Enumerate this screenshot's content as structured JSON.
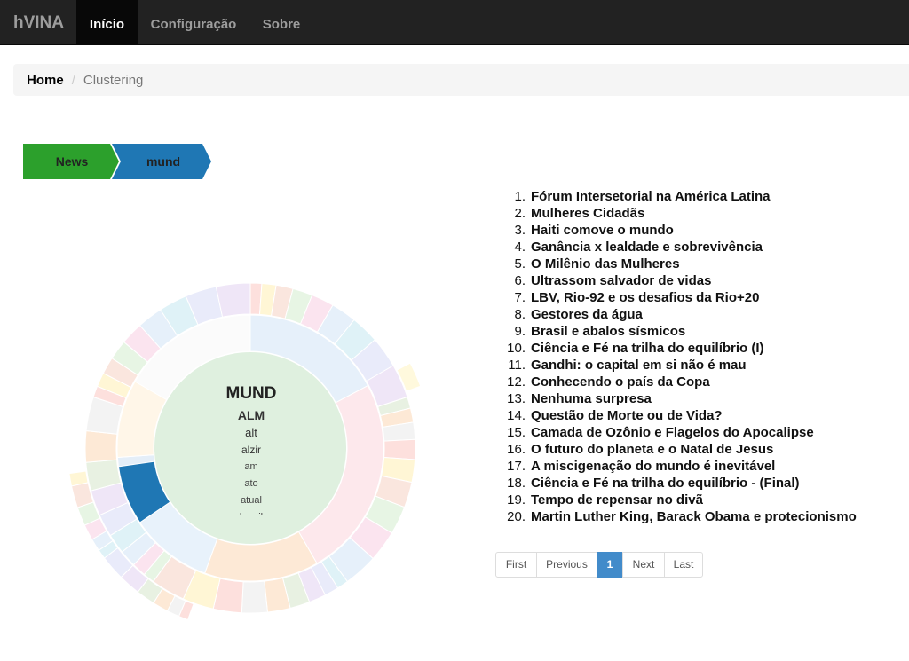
{
  "navbar": {
    "brand": "hVINA",
    "items": [
      {
        "label": "Início",
        "active": true
      },
      {
        "label": "Configuração",
        "active": false
      },
      {
        "label": "Sobre",
        "active": false
      }
    ]
  },
  "breadcrumb": {
    "home": "Home",
    "separator": "/",
    "current": "Clustering"
  },
  "trail": {
    "items": [
      {
        "label": "News",
        "color": "#2ca02c"
      },
      {
        "label": "mund",
        "color": "#1f77b4"
      }
    ]
  },
  "sunburst": {
    "center": {
      "title": "MUND",
      "labels": [
        "ALM",
        "alt",
        "alzir",
        "am",
        "ato",
        "atual",
        "brasil"
      ]
    },
    "highlight_color": "#1f77b4",
    "inner_color": "#dff0df"
  },
  "articles": {
    "items": [
      {
        "num": "1.",
        "title": "Fórum Intersetorial na América Latina"
      },
      {
        "num": "2.",
        "title": "Mulheres Cidadãs"
      },
      {
        "num": "3.",
        "title": "Haiti comove o mundo"
      },
      {
        "num": "4.",
        "title": "Ganância x lealdade e sobrevivência"
      },
      {
        "num": "5.",
        "title": "O Milênio das Mulheres"
      },
      {
        "num": "6.",
        "title": "Ultrassom salvador de vidas"
      },
      {
        "num": "7.",
        "title": "LBV, Rio-92 e os desafios da Rio+20"
      },
      {
        "num": "8.",
        "title": "Gestores da água"
      },
      {
        "num": "9.",
        "title": "Brasil e abalos sísmicos"
      },
      {
        "num": "10.",
        "title": "Ciência e Fé na trilha do equilíbrio (I)"
      },
      {
        "num": "11.",
        "title": "Gandhi: o capital em si não é mau"
      },
      {
        "num": "12.",
        "title": "Conhecendo o país da Copa"
      },
      {
        "num": "13.",
        "title": "Nenhuma surpresa"
      },
      {
        "num": "14.",
        "title": "Questão de Morte ou de Vida?"
      },
      {
        "num": "15.",
        "title": "Camada de Ozônio e Flagelos do Apocalipse"
      },
      {
        "num": "16.",
        "title": "O futuro do planeta e o Natal de Jesus"
      },
      {
        "num": "17.",
        "title": "A miscigenação do mundo é inevitável"
      },
      {
        "num": "18.",
        "title": "Ciência e Fé na trilha do equilíbrio - (Final)"
      },
      {
        "num": "19.",
        "title": "Tempo de repensar no divã"
      },
      {
        "num": "20.",
        "title": "Martin Luther King, Barack Obama e protecionismo"
      }
    ]
  },
  "pagination": {
    "first": "First",
    "previous": "Previous",
    "current": "1",
    "next": "Next",
    "last": "Last"
  }
}
